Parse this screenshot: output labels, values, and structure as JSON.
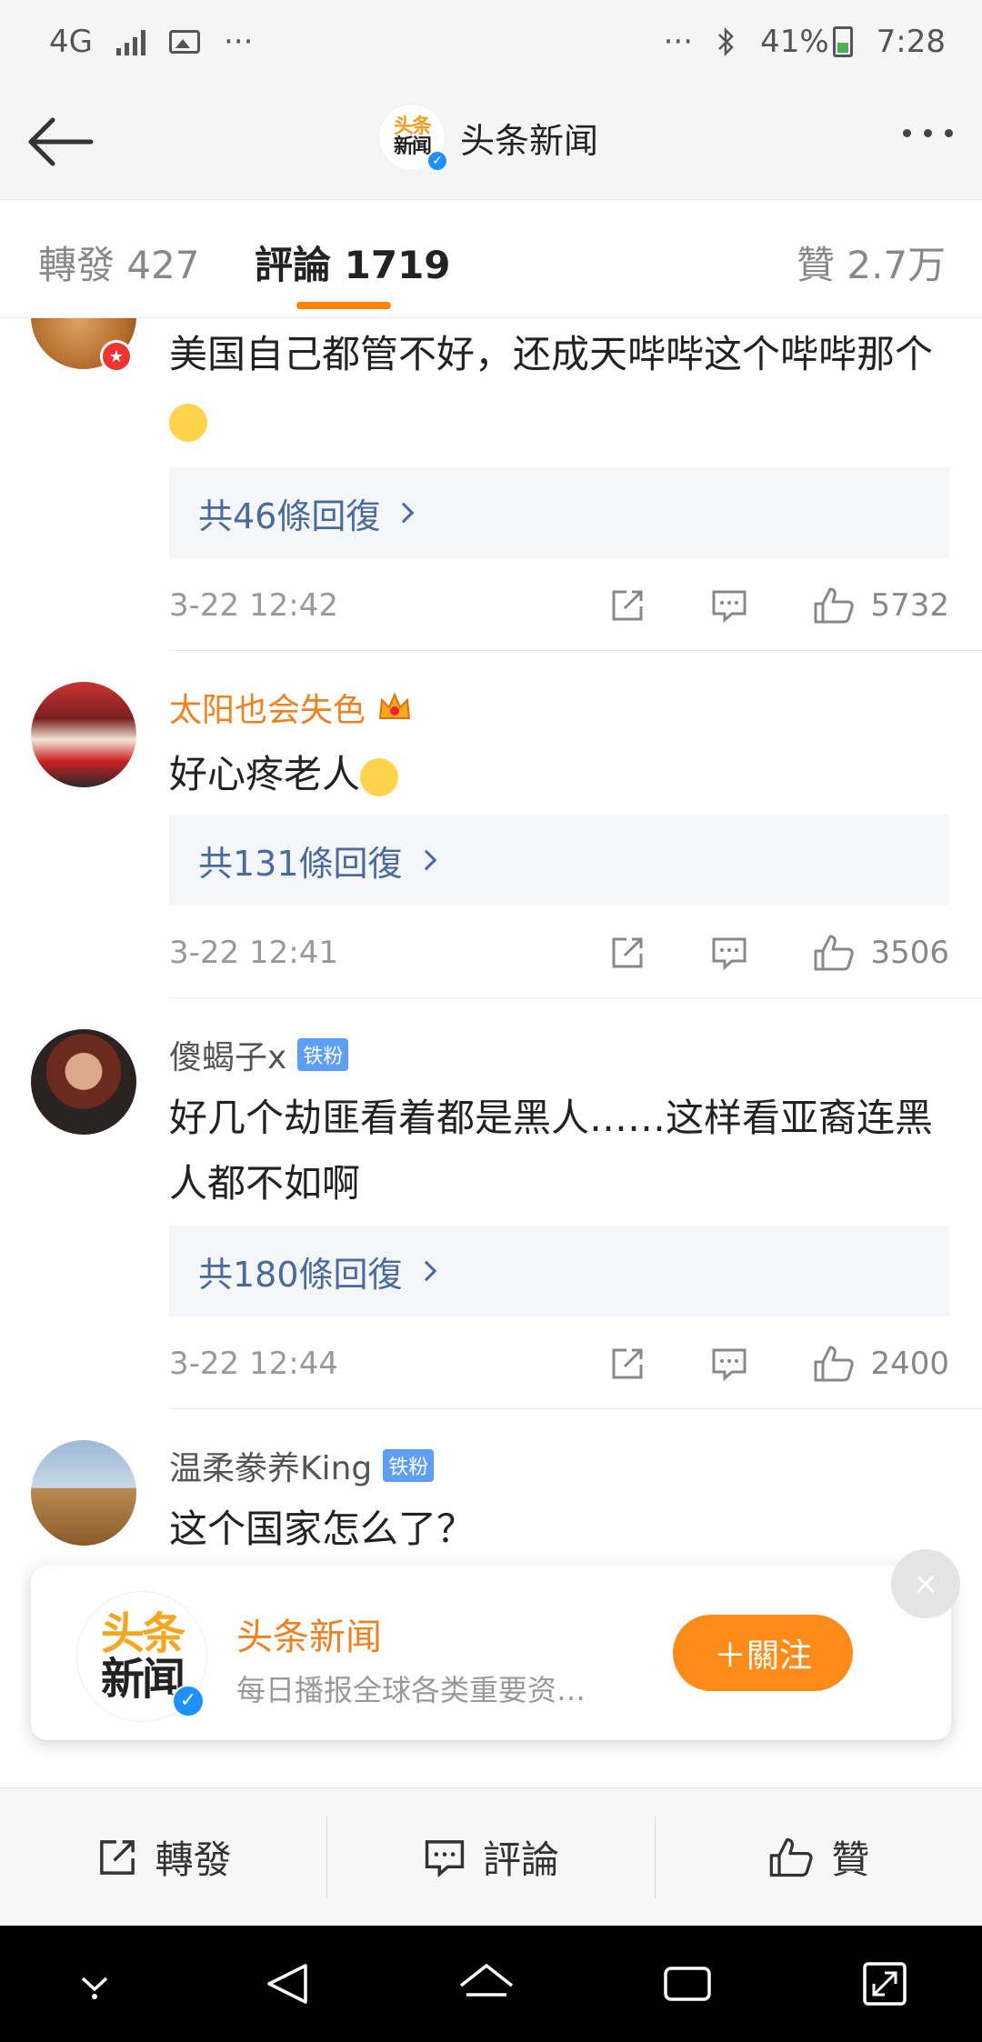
{
  "status_bar": {
    "network": "4G",
    "more": "···",
    "right_more": "···",
    "battery": "41%",
    "time": "7:28"
  },
  "nav": {
    "logo_line1": "头条",
    "logo_line2": "新闻",
    "title": "头条新闻"
  },
  "tabs": {
    "repost": "轉發 427",
    "comment": "評論 1719",
    "like": "贊 2.7万"
  },
  "comments": [
    {
      "text": "美国自己都管不好，还成天哔哔这个哔哔那个",
      "replies": "共46條回復",
      "time": "3-22 12:42",
      "likes": "5732"
    },
    {
      "user": "太阳也会失色",
      "text": "好心疼老人",
      "replies": "共131條回復",
      "time": "3-22 12:41",
      "likes": "3506"
    },
    {
      "user": "傻蝎子x",
      "badge": "铁粉",
      "text": "好几个劫匪看着都是黑人……这样看亚裔连黑人都不如啊",
      "replies": "共180條回復",
      "time": "3-22 12:44",
      "likes": "2400"
    },
    {
      "user": "温柔豢养King",
      "badge": "铁粉",
      "text": "这个国家怎么了？"
    }
  ],
  "follow_card": {
    "logo_line1": "头条",
    "logo_line2": "新闻",
    "name": "头条新闻",
    "desc": "每日播报全球各类重要资…",
    "button": "＋關注",
    "close": "×"
  },
  "toolbar": {
    "repost": "轉發",
    "comment": "評論",
    "like": "贊"
  },
  "colors": {
    "accent": "#ff8200",
    "link": "#4a6a9e",
    "vip_name": "#f08020"
  }
}
